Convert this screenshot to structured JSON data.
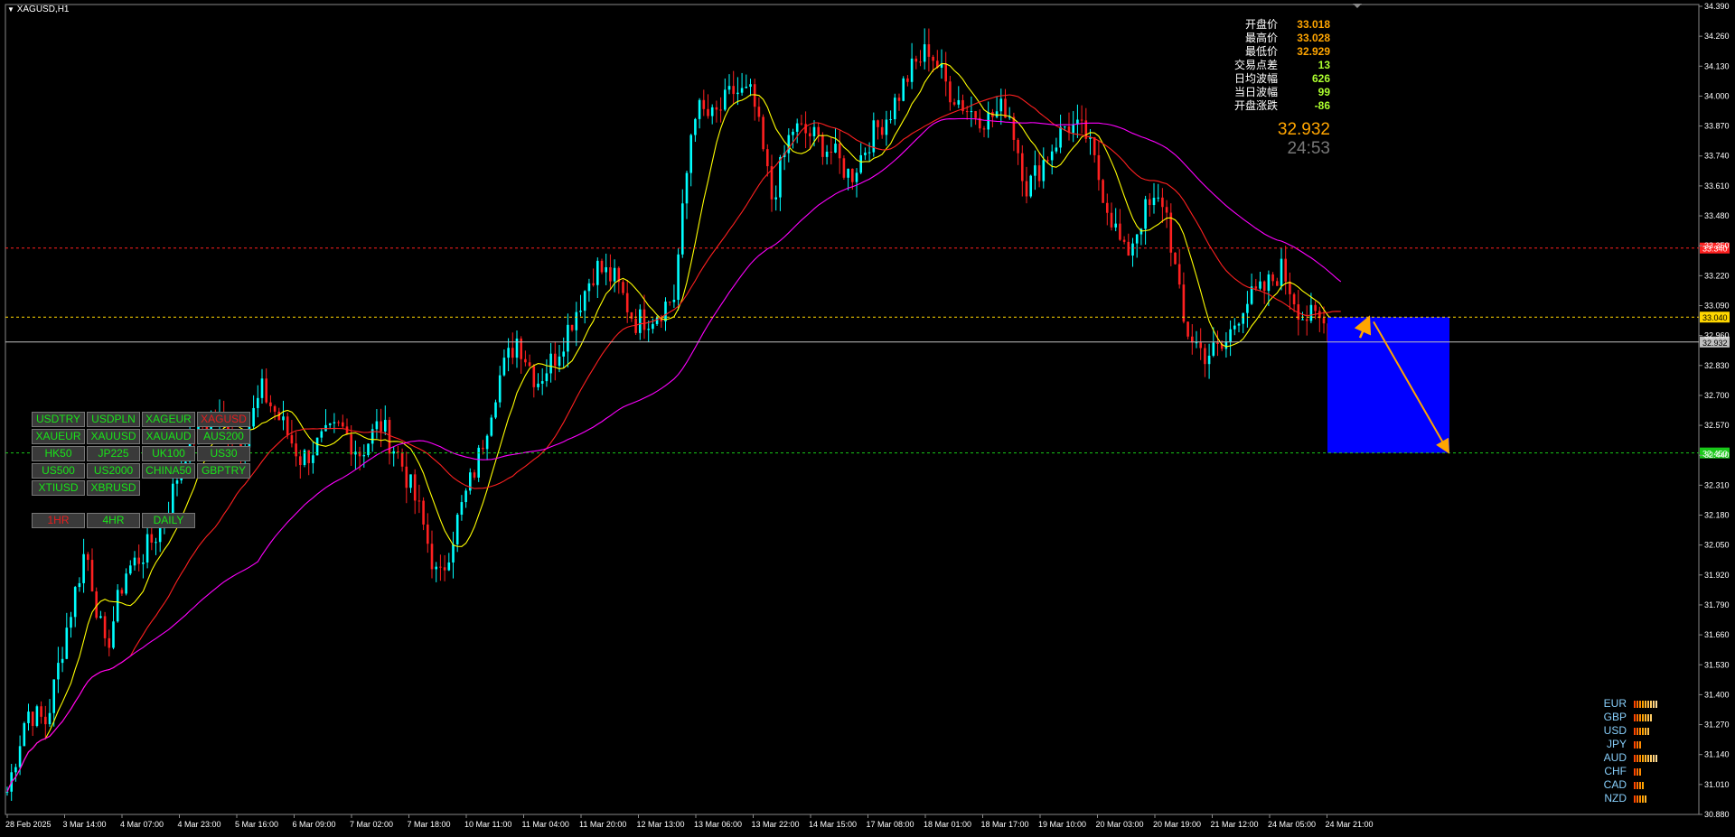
{
  "title": "XAGUSD,H1",
  "symbols": [
    {
      "label": "USDTRY",
      "active": false
    },
    {
      "label": "USDPLN",
      "active": false
    },
    {
      "label": "XAGEUR",
      "active": false
    },
    {
      "label": "XAGUSD",
      "active": true
    },
    {
      "label": "XAUEUR",
      "active": false
    },
    {
      "label": "XAUUSD",
      "active": false
    },
    {
      "label": "XAUAUD",
      "active": false
    },
    {
      "label": "AUS200",
      "active": false
    },
    {
      "label": "HK50",
      "active": false
    },
    {
      "label": "JP225",
      "active": false
    },
    {
      "label": "UK100",
      "active": false
    },
    {
      "label": "US30",
      "active": false
    },
    {
      "label": "US500",
      "active": false
    },
    {
      "label": "US2000",
      "active": false
    },
    {
      "label": "CHINA50",
      "active": false
    },
    {
      "label": "GBPTRY",
      "active": false
    },
    {
      "label": "XTIUSD",
      "active": false
    },
    {
      "label": "XBRUSD",
      "active": false
    }
  ],
  "timeframes": [
    {
      "label": "1HR",
      "active": true
    },
    {
      "label": "4HR",
      "active": false
    },
    {
      "label": "DAILY",
      "active": false
    }
  ],
  "info": [
    {
      "label": "开盘价",
      "value": "33.018",
      "color": "#ffa500"
    },
    {
      "label": "最高价",
      "value": "33.028",
      "color": "#ffa500"
    },
    {
      "label": "最低价",
      "value": "32.929",
      "color": "#ffa500"
    },
    {
      "label": "交易点差",
      "value": "13",
      "color": "#adff2f"
    },
    {
      "label": "日均波幅",
      "value": "626",
      "color": "#adff2f"
    },
    {
      "label": "当日波幅",
      "value": "99",
      "color": "#adff2f"
    },
    {
      "label": "开盘涨跌",
      "value": "-86",
      "color": "#adff2f"
    }
  ],
  "current_price": "32.932",
  "timer": "24:53",
  "strength": [
    {
      "currency": "EUR",
      "level": 9
    },
    {
      "currency": "GBP",
      "level": 7
    },
    {
      "currency": "USD",
      "level": 6
    },
    {
      "currency": "JPY",
      "level": 3
    },
    {
      "currency": "AUD",
      "level": 9
    },
    {
      "currency": "CHF",
      "level": 3
    },
    {
      "currency": "CAD",
      "level": 4
    },
    {
      "currency": "NZD",
      "level": 5
    }
  ],
  "chart_data": {
    "type": "candlestick",
    "symbol": "XAGUSD",
    "timeframe": "H1",
    "ylim": [
      30.88,
      34.39
    ],
    "y_ticks": [
      "34.390",
      "34.260",
      "34.130",
      "34.000",
      "33.870",
      "33.740",
      "33.610",
      "33.480",
      "33.350",
      "33.220",
      "33.090",
      "32.960",
      "32.830",
      "32.700",
      "32.570",
      "32.440",
      "32.310",
      "32.180",
      "32.050",
      "31.920",
      "31.790",
      "31.660",
      "31.530",
      "31.400",
      "31.270",
      "31.140",
      "31.010",
      "30.880"
    ],
    "x_ticks": [
      "28 Feb 2025",
      "3 Mar 14:00",
      "4 Mar 07:00",
      "4 Mar 23:00",
      "5 Mar 16:00",
      "6 Mar 09:00",
      "7 Mar 02:00",
      "7 Mar 18:00",
      "10 Mar 11:00",
      "11 Mar 04:00",
      "11 Mar 20:00",
      "12 Mar 13:00",
      "13 Mar 06:00",
      "13 Mar 22:00",
      "14 Mar 15:00",
      "17 Mar 08:00",
      "18 Mar 01:00",
      "18 Mar 17:00",
      "19 Mar 10:00",
      "20 Mar 03:00",
      "20 Mar 19:00",
      "21 Mar 12:00",
      "24 Mar 05:00",
      "24 Mar 21:00"
    ],
    "price_path": [
      30.98,
      31.33,
      31.28,
      31.68,
      32.04,
      31.58,
      31.93,
      32.02,
      32.15,
      32.45,
      32.58,
      32.6,
      32.5,
      32.72,
      32.58,
      32.42,
      32.5,
      32.56,
      32.45,
      32.58,
      32.43,
      32.2,
      31.88,
      32.17,
      32.42,
      32.76,
      32.95,
      32.76,
      32.88,
      33.07,
      33.26,
      33.2,
      33.02,
      33.05,
      33.13,
      33.95,
      33.9,
      34.02,
      34.0,
      33.55,
      33.86,
      33.83,
      33.76,
      33.65,
      33.82,
      33.93,
      34.1,
      34.21,
      34.03,
      33.94,
      33.9,
      33.96,
      33.6,
      33.74,
      33.88,
      33.83,
      33.55,
      33.3,
      33.5,
      33.55,
      33.0,
      32.88,
      32.9,
      33.1,
      33.15,
      33.25,
      33.05,
      33.02,
      32.93
    ],
    "bars_count": 315,
    "horizontal_lines": [
      {
        "price": 33.34,
        "color": "#ff2020",
        "label": "33.340",
        "style": "dashed"
      },
      {
        "price": 33.04,
        "color": "#ffd700",
        "label": "33.040",
        "style": "dashed"
      },
      {
        "price": 32.932,
        "color": "#c0c0c0",
        "label": "32.932",
        "style": "solid"
      },
      {
        "price": 32.45,
        "color": "#19c919",
        "label": "32.450",
        "style": "dashed"
      }
    ],
    "target_box": {
      "price_top": 33.04,
      "price_bottom": 32.45,
      "color": "#0000ff"
    },
    "arrows": [
      {
        "from_bar": 297,
        "from_price": 32.95,
        "to_bar": 302,
        "to_price": 33.03,
        "color": "#ffa500"
      },
      {
        "from_bar": 303,
        "from_price": 33.02,
        "to_bar": 326,
        "to_price": 32.46,
        "color": "#ffa500"
      }
    ],
    "moving_averages": [
      {
        "period": 10,
        "color": "#ffff00"
      },
      {
        "period": 30,
        "color": "#ff2020"
      },
      {
        "period": 60,
        "color": "#ff00ff"
      }
    ],
    "bull_color": "#00ffff",
    "bear_color": "#ff2020"
  }
}
